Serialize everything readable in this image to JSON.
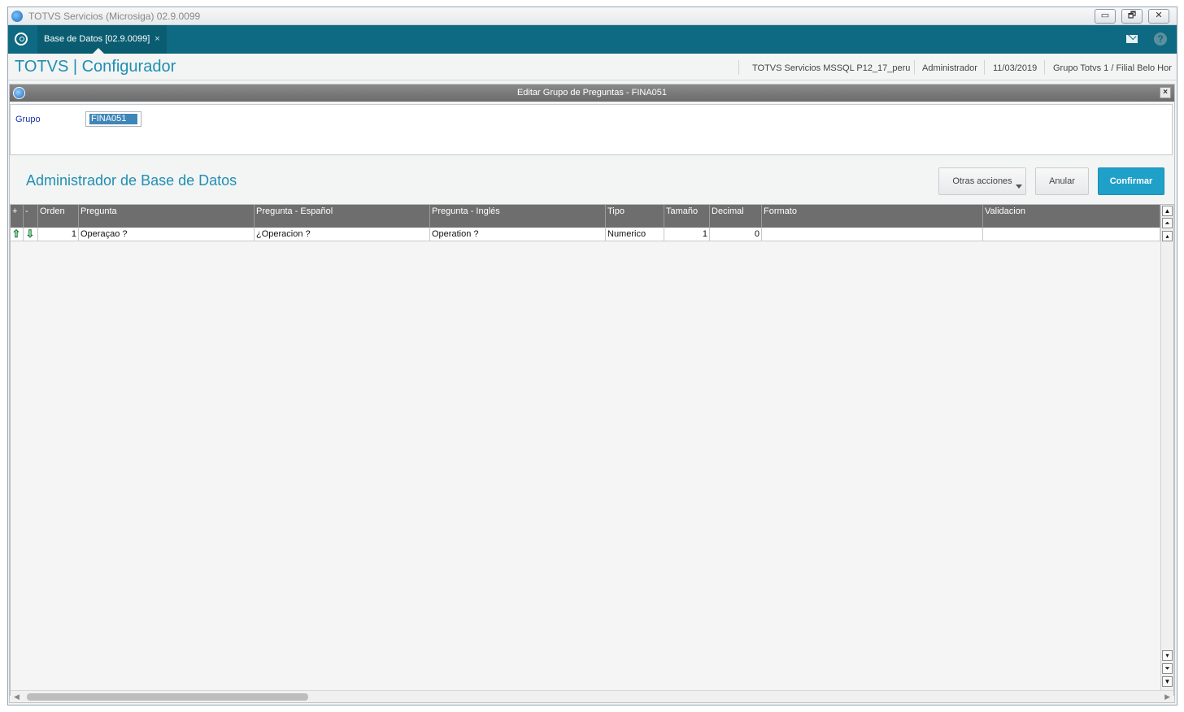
{
  "window": {
    "title": "TOTVS Servicios (Microsiga) 02.9.0099"
  },
  "tab": {
    "label": "Base de Datos [02.9.0099]",
    "close": "×"
  },
  "header": {
    "brand": "TOTVS | Configurador",
    "environment": "TOTVS Servicios MSSQL P12_17_peru",
    "user": "Administrador",
    "date": "11/03/2019",
    "branch": "Grupo Totvs 1 / Filial Belo Hor"
  },
  "dialog": {
    "title": "Editar Grupo de Preguntas - FINA051",
    "group_label": "Grupo",
    "group_value": "FINA051",
    "section_title": "Administrador de Base de Datos",
    "buttons": {
      "other": "Otras acciones",
      "cancel": "Anular",
      "confirm": "Confirmar"
    }
  },
  "grid": {
    "columns": [
      "+",
      "-",
      "Orden",
      "Pregunta",
      "Pregunta - Español",
      "Pregunta - Inglés",
      "Tipo",
      "Tamaño",
      "Decimal",
      "Formato",
      "Validacion"
    ],
    "rows": [
      {
        "orden": "1",
        "pregunta": "Operaçao ?",
        "pregunta_es": "¿Operacion ?",
        "pregunta_en": "Operation ?",
        "tipo": "Numerico",
        "tamano": "1",
        "decimal": "0",
        "formato": "",
        "validacion": ""
      }
    ]
  },
  "colors": {
    "accent": "#1f8fb3",
    "tabbar": "#0e6a82",
    "primary_button": "#1fa0c8",
    "grid_header": "#6e6e6e"
  }
}
